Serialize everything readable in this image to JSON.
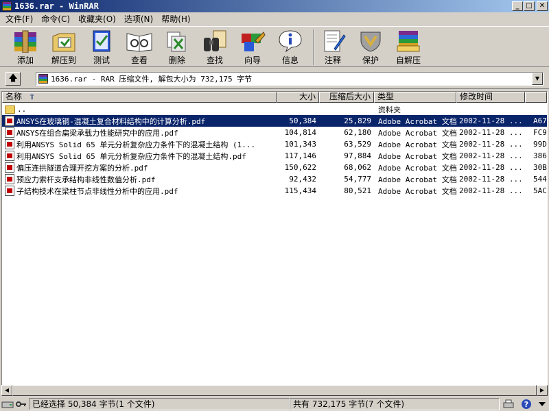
{
  "window": {
    "title": "1636.rar - WinRAR",
    "min": "_",
    "max": "□",
    "close": "✕"
  },
  "menu": [
    "文件(F)",
    "命令(C)",
    "收藏夹(O)",
    "选项(N)",
    "帮助(H)"
  ],
  "toolbar": [
    {
      "label": "添加",
      "icon": "add-archive-icon"
    },
    {
      "label": "解压到",
      "icon": "extract-to-icon"
    },
    {
      "label": "测试",
      "icon": "test-icon"
    },
    {
      "label": "查看",
      "icon": "view-icon"
    },
    {
      "label": "删除",
      "icon": "delete-icon"
    },
    {
      "label": "查找",
      "icon": "find-icon"
    },
    {
      "label": "向导",
      "icon": "wizard-icon"
    },
    {
      "label": "信息",
      "icon": "info-icon"
    },
    {
      "label": "注释",
      "icon": "comment-icon"
    },
    {
      "label": "保护",
      "icon": "protect-icon"
    },
    {
      "label": "自解压",
      "icon": "sfx-icon"
    }
  ],
  "address": {
    "text": "1636.rar - RAR 压缩文件, 解包大小为 732,175 字节"
  },
  "columns": {
    "name": "名称",
    "size": "大小",
    "packed": "压缩后大小",
    "type": "类型",
    "modified": "修改时间"
  },
  "rows": [
    {
      "name": "..",
      "size": "",
      "packed": "",
      "type": "资料夹",
      "modified": "",
      "crc": "",
      "kind": "folder",
      "selected": false
    },
    {
      "name": "ANSYS在玻璃钢-混凝土复合材料结构中的计算分析.pdf",
      "size": "50,384",
      "packed": "25,829",
      "type": "Adobe Acrobat 文档",
      "modified": "2002-11-28 ...",
      "crc": "A67",
      "kind": "pdf",
      "selected": true
    },
    {
      "name": "ANSYS在组合扁梁承载力性能研究中的应用.pdf",
      "size": "104,814",
      "packed": "62,180",
      "type": "Adobe Acrobat 文档",
      "modified": "2002-11-28 ...",
      "crc": "FC9",
      "kind": "pdf",
      "selected": false
    },
    {
      "name": "利用ANSYS Solid 65 单元分析复杂应力条件下的混凝土结构 (1...",
      "size": "101,343",
      "packed": "63,529",
      "type": "Adobe Acrobat 文档",
      "modified": "2002-11-28 ...",
      "crc": "99D",
      "kind": "pdf",
      "selected": false
    },
    {
      "name": "利用ANSYS Solid 65 单元分析复杂应力条件下的混凝土结构.pdf",
      "size": "117,146",
      "packed": "97,884",
      "type": "Adobe Acrobat 文档",
      "modified": "2002-11-28 ...",
      "crc": "386",
      "kind": "pdf",
      "selected": false
    },
    {
      "name": "偏压连拱隧道合理开挖方案的分析.pdf",
      "size": "150,622",
      "packed": "68,062",
      "type": "Adobe Acrobat 文档",
      "modified": "2002-11-28 ...",
      "crc": "30B",
      "kind": "pdf",
      "selected": false
    },
    {
      "name": "预应力索杆支承结构非线性数值分析.pdf",
      "size": "92,432",
      "packed": "54,777",
      "type": "Adobe Acrobat 文档",
      "modified": "2002-11-28 ...",
      "crc": "544",
      "kind": "pdf",
      "selected": false
    },
    {
      "name": "子结构技术在梁柱节点非线性分析中的应用.pdf",
      "size": "115,434",
      "packed": "80,521",
      "type": "Adobe Acrobat 文档",
      "modified": "2002-11-28 ...",
      "crc": "5AC",
      "kind": "pdf",
      "selected": false
    }
  ],
  "status": {
    "selected": "已经选择 50,384 字节(1 个文件)",
    "total": "共有 732,175 字节(7 个文件)"
  },
  "colors": {
    "titlebar": "#0a246a",
    "selection": "#0a246a",
    "face": "#d4d0c8"
  }
}
